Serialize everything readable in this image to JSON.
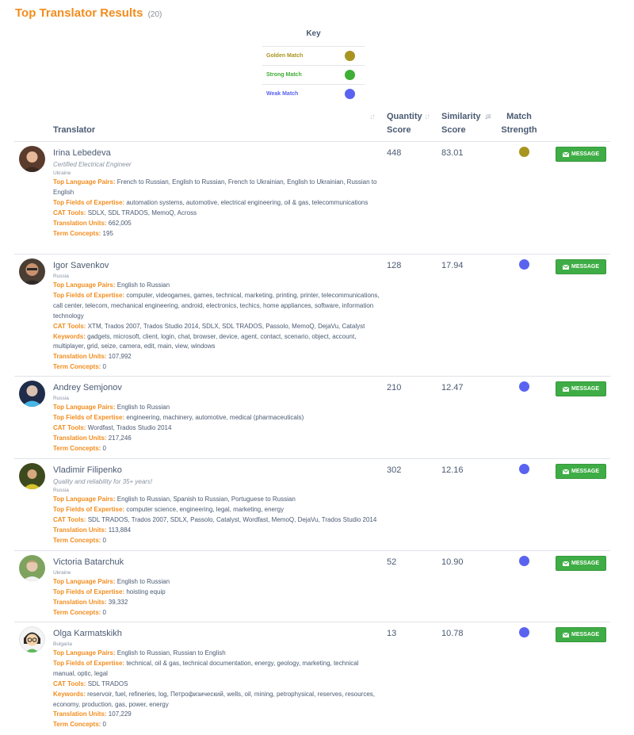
{
  "header": {
    "title": "Top Translator Results",
    "count": "(20)"
  },
  "key": {
    "title": "Key",
    "items": [
      {
        "label": "Golden Match",
        "color": "#a8951f"
      },
      {
        "label": "Strong Match",
        "color": "#3fae36"
      },
      {
        "label": "Weak Match",
        "color": "#5a63f0"
      }
    ]
  },
  "columns": {
    "translator": "Translator",
    "quantity_1": "Quantity",
    "quantity_2": "Score",
    "similarity_1": "Similarity",
    "similarity_2": "Score",
    "strength_1": "Match",
    "strength_2": "Strength"
  },
  "labels": {
    "language_pairs": "Top Language Pairs:",
    "fields": "Top Fields of Expertise:",
    "cat_tools": "CAT Tools:",
    "keywords": "Keywords:",
    "units": "Translation Units:",
    "terms": "Term Concepts:",
    "message": "MESSAGE"
  },
  "colors": {
    "accent": "#f28c1d",
    "button": "#3fad45",
    "golden": "#a8951f",
    "weak": "#5a63f0"
  },
  "results": [
    {
      "name": "Irina Lebedeva",
      "tagline": "Certified Electrical Engineer",
      "country": "Ukraine",
      "language_pairs": "French to Russian, English to Russian, French to Ukrainian, English to Ukrainian, Russian to English",
      "fields": "automation systems, automotive, electrical engineering, oil & gas, telecommunications",
      "cat_tools": "SDLX, SDL TRADOS, MemoQ, Across",
      "units": "662,005",
      "terms": "195",
      "quantity": "448",
      "similarity": "83.01",
      "strength": "golden"
    },
    {
      "name": "Igor Savenkov",
      "country": "Russia",
      "language_pairs": "English to Russian",
      "fields": "computer, videogames, games, technical, marketing, printing, printer, telecommunications, call center, telecom, mechanical engineering, android, electronics, techics, home appliances, software, information technology",
      "cat_tools": "XTM, Trados 2007, Trados Studio 2014, SDLX, SDL TRADOS, Passolo, MemoQ, DejaVu, Catalyst",
      "keywords": "gadgets, microsoft, client, login, chat, browser, device, agent, contact, scenario, object, account, multiplayer, grid, seize, camera, edit, main, view, windows",
      "units": "107,992",
      "terms": "0",
      "quantity": "128",
      "similarity": "17.94",
      "strength": "weak"
    },
    {
      "name": "Andrey Semjonov",
      "country": "Russia",
      "language_pairs": "English to Russian",
      "fields": "engineering, machinery, automotive, medical (pharmaceuticals)",
      "cat_tools": "Wordfast, Trados Studio 2014",
      "units": "217,246",
      "terms": "0",
      "quantity": "210",
      "similarity": "12.47",
      "strength": "weak"
    },
    {
      "name": "Vladimir Filipenko",
      "tagline": "Quality and reliability for 35+ years!",
      "country": "Russia",
      "language_pairs": "English to Russian, Spanish to Russian, Portuguese to Russian",
      "fields": "computer science, engineering, legal, marketing, energy",
      "cat_tools": "SDL TRADOS, Trados 2007, SDLX, Passolo, Catalyst, Wordfast, MemoQ, DejaVu, Trados Studio 2014",
      "units": "113,884",
      "terms": "0",
      "quantity": "302",
      "similarity": "12.16",
      "strength": "weak"
    },
    {
      "name": "Victoria Batarchuk",
      "country": "Ukraine",
      "language_pairs": "English to Russian",
      "fields": "hoisting equip",
      "units": "39,332",
      "terms": "0",
      "quantity": "52",
      "similarity": "10.90",
      "strength": "weak"
    },
    {
      "name": "Olga Karmatskikh",
      "country": "Bulgaria",
      "language_pairs": "English to Russian, Russian to English",
      "fields": "technical, oil & gas, technical documentation, energy, geology, marketing, technical manual, optic, legal",
      "cat_tools": "SDL TRADOS",
      "keywords": "reservoir, fuel, refineries, log, Петрофизический, wells, oil, mining, petrophysical, reserves, resources, economy, production, gas, power, energy",
      "units": "107,229",
      "terms": "0",
      "quantity": "13",
      "similarity": "10.78",
      "strength": "weak"
    }
  ]
}
